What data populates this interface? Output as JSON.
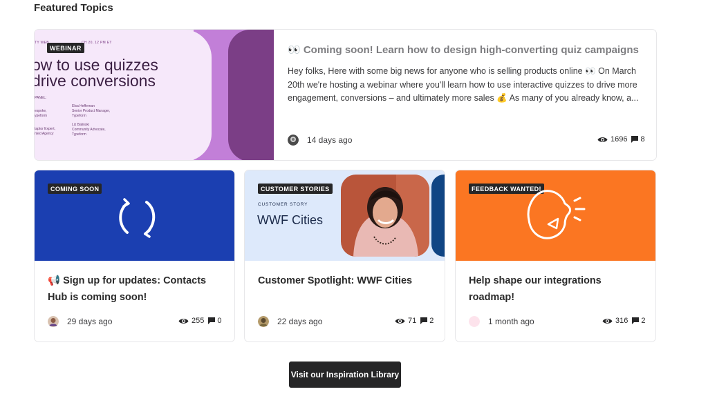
{
  "section": {
    "title": "Featured Topics"
  },
  "featured": {
    "badge": "WEBINAR",
    "thumb_topline_left": "TY WEB",
    "thumb_topline_right": "CH 20, 12 PM ET",
    "thumb_line1": "ow to use quizzes",
    "thumb_line2": "drive conversions",
    "thumb_panel": "PANEL:",
    "thumb_person1_name": "Elsa Heffernan",
    "thumb_person1_role": "Senior Product Manager,",
    "thumb_person1_org": "Typeform",
    "thumb_person2_name": "Liz Balinski",
    "thumb_person2_role": "Community Advocate,",
    "thumb_person2_org": "Typeform",
    "thumb_left1": "espoke,",
    "thumb_left2": "ypeform",
    "thumb_left3": "taptor Expert,",
    "thumb_left4": "nted Agency",
    "title": "👀 Coming soon! Learn how to design high-converting quiz campaigns",
    "excerpt": "Hey folks, Here with some big news for anyone who is selling products online 👀 On March 20th we're hosting a webinar where you'll learn how to use interactive quizzes to drive more engagement, conversions – and ultimately more sales 💰 As many of you already know, a...",
    "time": "14 days ago",
    "views": "1696",
    "replies": "8"
  },
  "cards": [
    {
      "badge": "COMING SOON",
      "title": "📢 Sign up for updates: Contacts Hub is coming soon!",
      "time": "29 days ago",
      "views": "255",
      "replies": "0",
      "color": "#1b3fb1"
    },
    {
      "badge": "CUSTOMER STORIES",
      "story_label": "CUSTOMER STORY",
      "story_title": "WWF Cities",
      "title": "Customer Spotlight: WWF Cities",
      "time": "22 days ago",
      "views": "71",
      "replies": "2",
      "color": "#dde9fb"
    },
    {
      "badge": "FEEDBACK WANTED!",
      "title": "Help shape our integrations roadmap!",
      "time": "1 month ago",
      "views": "316",
      "replies": "2",
      "color": "#fb7622"
    }
  ],
  "cta": {
    "label": "Visit our Inspiration Library"
  },
  "icons": {
    "views": "eye-icon",
    "replies": "comment-icon"
  }
}
